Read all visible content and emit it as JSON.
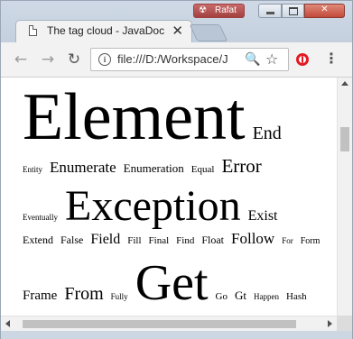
{
  "window": {
    "tab_title": "The tag cloud - JavaDoc",
    "tab_close": "✕",
    "profile": {
      "logo": "☢",
      "name": "Rafat"
    },
    "controls": {
      "close": "✕"
    }
  },
  "toolbar": {
    "back": "←",
    "forward": "→",
    "reload": "↻",
    "url_scheme_icon": "i",
    "url": "file:///D:/Workspace/J",
    "zoom": "🔍",
    "bookmark": "☆",
    "menu": "⋮"
  },
  "tag_cloud": {
    "lines": [
      [
        {
          "text": "Element",
          "size": 74
        },
        {
          "text": "End",
          "size": 20
        }
      ],
      [
        {
          "text": "Entity",
          "size": 9
        },
        {
          "text": "Enumerate",
          "size": 17
        },
        {
          "text": "Enumeration",
          "size": 13
        },
        {
          "text": "Equal",
          "size": 11
        },
        {
          "text": "Error",
          "size": 21
        }
      ],
      [
        {
          "text": "Eventually",
          "size": 9
        },
        {
          "text": "Exception",
          "size": 48
        },
        {
          "text": "Exist",
          "size": 16
        }
      ],
      [
        {
          "text": "Extend",
          "size": 12
        },
        {
          "text": "False",
          "size": 12
        },
        {
          "text": "Field",
          "size": 16
        },
        {
          "text": "Fill",
          "size": 11
        },
        {
          "text": "Final",
          "size": 11
        },
        {
          "text": "Find",
          "size": 11
        },
        {
          "text": "Float",
          "size": 12
        },
        {
          "text": "Follow",
          "size": 17
        },
        {
          "text": "For",
          "size": 9
        },
        {
          "text": "Form",
          "size": 10
        }
      ],
      [
        {
          "text": "Frame",
          "size": 15
        },
        {
          "text": "From",
          "size": 20
        },
        {
          "text": "Fully",
          "size": 9
        },
        {
          "text": "Get",
          "size": 56
        },
        {
          "text": "Go",
          "size": 11
        },
        {
          "text": "Gt",
          "size": 13
        },
        {
          "text": "Happen",
          "size": 9
        },
        {
          "text": "Hash",
          "size": 11
        }
      ]
    ]
  }
}
